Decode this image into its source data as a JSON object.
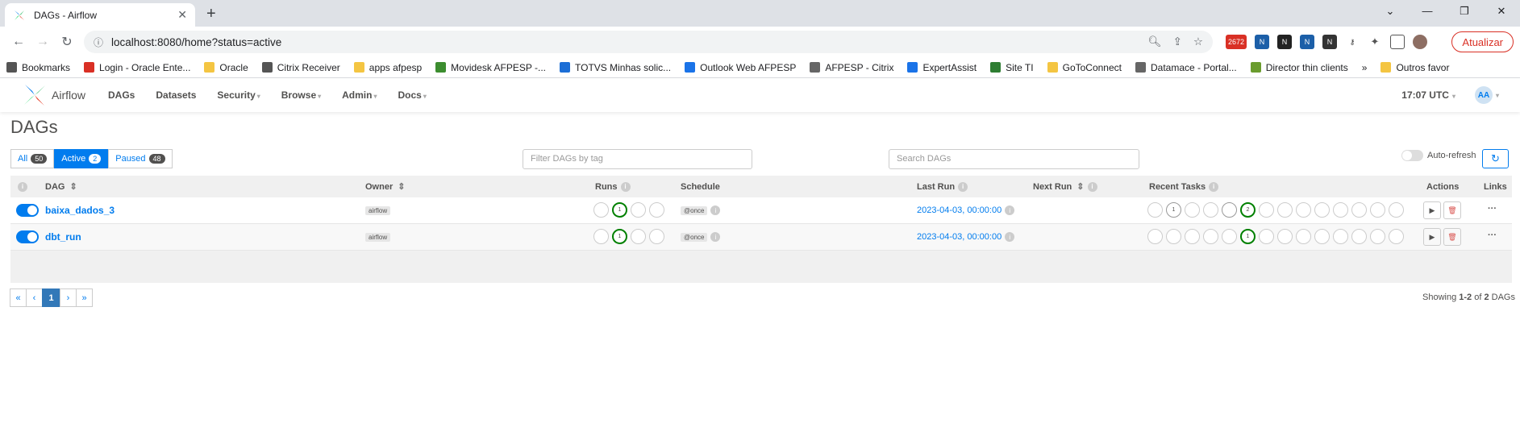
{
  "browser": {
    "tab_title": "DAGs - Airflow",
    "url": "localhost:8080/home?status=active",
    "update_label": "Atualizar",
    "gmail_count": "2672",
    "bookmarks": [
      {
        "label": "Bookmarks",
        "color": "#555"
      },
      {
        "label": "Login - Oracle Ente...",
        "color": "#d93025"
      },
      {
        "label": "Oracle",
        "color": "#f4c542"
      },
      {
        "label": "Citrix Receiver",
        "color": "#555"
      },
      {
        "label": "apps afpesp",
        "color": "#f4c542"
      },
      {
        "label": "Movidesk AFPESP -...",
        "color": "#3c8d2f"
      },
      {
        "label": "TOTVS Minhas solic...",
        "color": "#1c6ed6"
      },
      {
        "label": "Outlook Web AFPESP",
        "color": "#1a73e8"
      },
      {
        "label": "AFPESP - Citrix",
        "color": "#666"
      },
      {
        "label": "ExpertAssist",
        "color": "#1a73e8"
      },
      {
        "label": "Site TI",
        "color": "#2e7d32"
      },
      {
        "label": "GoToConnect",
        "color": "#f4c542"
      },
      {
        "label": "Datamace - Portal...",
        "color": "#666"
      },
      {
        "label": "Director thin clients",
        "color": "#6a9c2e"
      }
    ],
    "other_bookmarks": "Outros favor"
  },
  "navbar": {
    "brand": "Airflow",
    "items": [
      "DAGs",
      "Datasets",
      "Security",
      "Browse",
      "Admin",
      "Docs"
    ],
    "time": "17:07 UTC",
    "avatar": "AA"
  },
  "page": {
    "title": "DAGs",
    "filters": {
      "all": {
        "label": "All",
        "count": "50"
      },
      "active": {
        "label": "Active",
        "count": "2"
      },
      "paused": {
        "label": "Paused",
        "count": "48"
      }
    },
    "tag_placeholder": "Filter DAGs by tag",
    "search_placeholder": "Search DAGs",
    "auto_refresh": "Auto-refresh"
  },
  "table": {
    "headers": {
      "dag": "DAG",
      "owner": "Owner",
      "runs": "Runs",
      "schedule": "Schedule",
      "last_run": "Last Run",
      "next_run": "Next Run",
      "recent_tasks": "Recent Tasks",
      "actions": "Actions",
      "links": "Links"
    },
    "rows": [
      {
        "dag": "baixa_dados_3",
        "owner": "airflow",
        "runs_success": "1",
        "schedule": "@once",
        "last_run": "2023-04-03, 00:00:00",
        "tasks_removed": "1",
        "tasks_success": "2"
      },
      {
        "dag": "dbt_run",
        "owner": "airflow",
        "runs_success": "1",
        "schedule": "@once",
        "last_run": "2023-04-03, 00:00:00",
        "tasks_removed": "",
        "tasks_success": "1"
      }
    ]
  },
  "pagination": {
    "first": "«",
    "prev": "‹",
    "current": "1",
    "next": "›",
    "last": "»",
    "showing_prefix": "Showing ",
    "showing_range": "1-2",
    "showing_of": " of ",
    "showing_total": "2",
    "showing_suffix": " DAGs"
  }
}
